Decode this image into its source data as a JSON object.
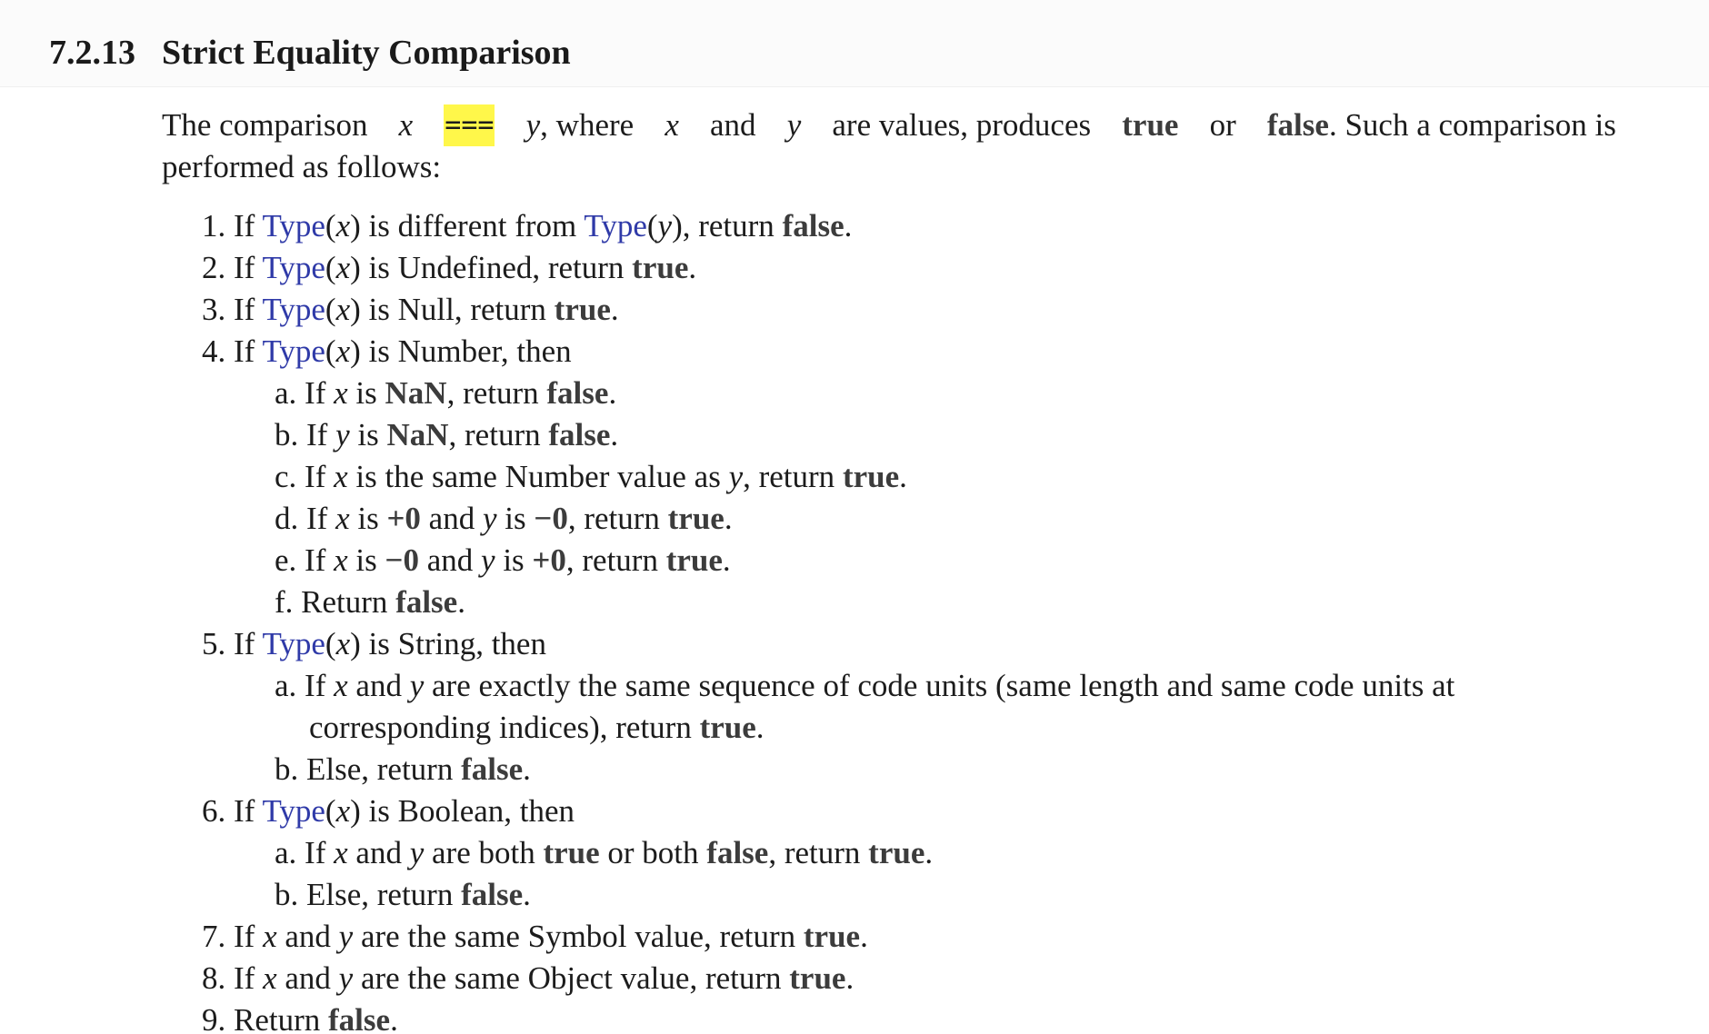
{
  "section": {
    "number": "7.2.13",
    "title": "Strict Equality Comparison"
  },
  "intro": {
    "text1": "The comparison",
    "x": "x",
    "operator": "===",
    "y": "y",
    "text2": ", where",
    "text3": "and",
    "text4": "are values, produces",
    "true": "true",
    "or": "or",
    "false": "false",
    "text5": ". Such a comparison is",
    "line2": "performed as follows:"
  },
  "words": {
    "if": "If",
    "type": "Type",
    "is": "is",
    "and": "and",
    "true": "true",
    "false": "false",
    "return": "return",
    "nan": "NaN",
    "plus_zero": "+0",
    "minus_zero": "−0",
    "x": "x",
    "y": "y"
  },
  "steps": [
    {
      "num": "1.",
      "tail": ") is different from ",
      "tail2": "), return "
    },
    {
      "num": "2.",
      "tail": ") is Undefined, return "
    },
    {
      "num": "3.",
      "tail": ") is Null, return "
    },
    {
      "num": "4.",
      "tail": ") is Number, then",
      "sub": [
        {
          "letter": "a.",
          "tail": " is ",
          "tail2": ", return "
        },
        {
          "letter": "b.",
          "tail": " is ",
          "tail2": ", return "
        },
        {
          "letter": "c.",
          "tail": " is the same Number value as ",
          "tail2": ", return "
        },
        {
          "letter": "d.",
          "tail": " is ",
          "tail2": " and ",
          "tail3": " is ",
          "tail4": ", return "
        },
        {
          "letter": "e.",
          "tail": " is ",
          "tail2": " and ",
          "tail3": " is ",
          "tail4": ", return "
        },
        {
          "letter": "f.",
          "text": "Return "
        }
      ]
    },
    {
      "num": "5.",
      "tail": ") is String, then",
      "sub": [
        {
          "letter": "a.",
          "tail": " and ",
          "tail2": " are exactly the same sequence of code units (same length and same code units at",
          "line2": "corresponding indices), return "
        },
        {
          "letter": "b.",
          "text": "Else, return "
        }
      ]
    },
    {
      "num": "6.",
      "tail": ") is Boolean, then",
      "sub": [
        {
          "letter": "a.",
          "tail": " and ",
          "tail2": " are both ",
          "tail3": " or both ",
          "tail4": ", return "
        },
        {
          "letter": "b.",
          "text": "Else, return "
        }
      ]
    },
    {
      "num": "7.",
      "tail": " and ",
      "tail2": " are the same Symbol value, return "
    },
    {
      "num": "8.",
      "tail": " and ",
      "tail2": " are the same Object value, return "
    },
    {
      "num": "9.",
      "text": "Return "
    }
  ]
}
